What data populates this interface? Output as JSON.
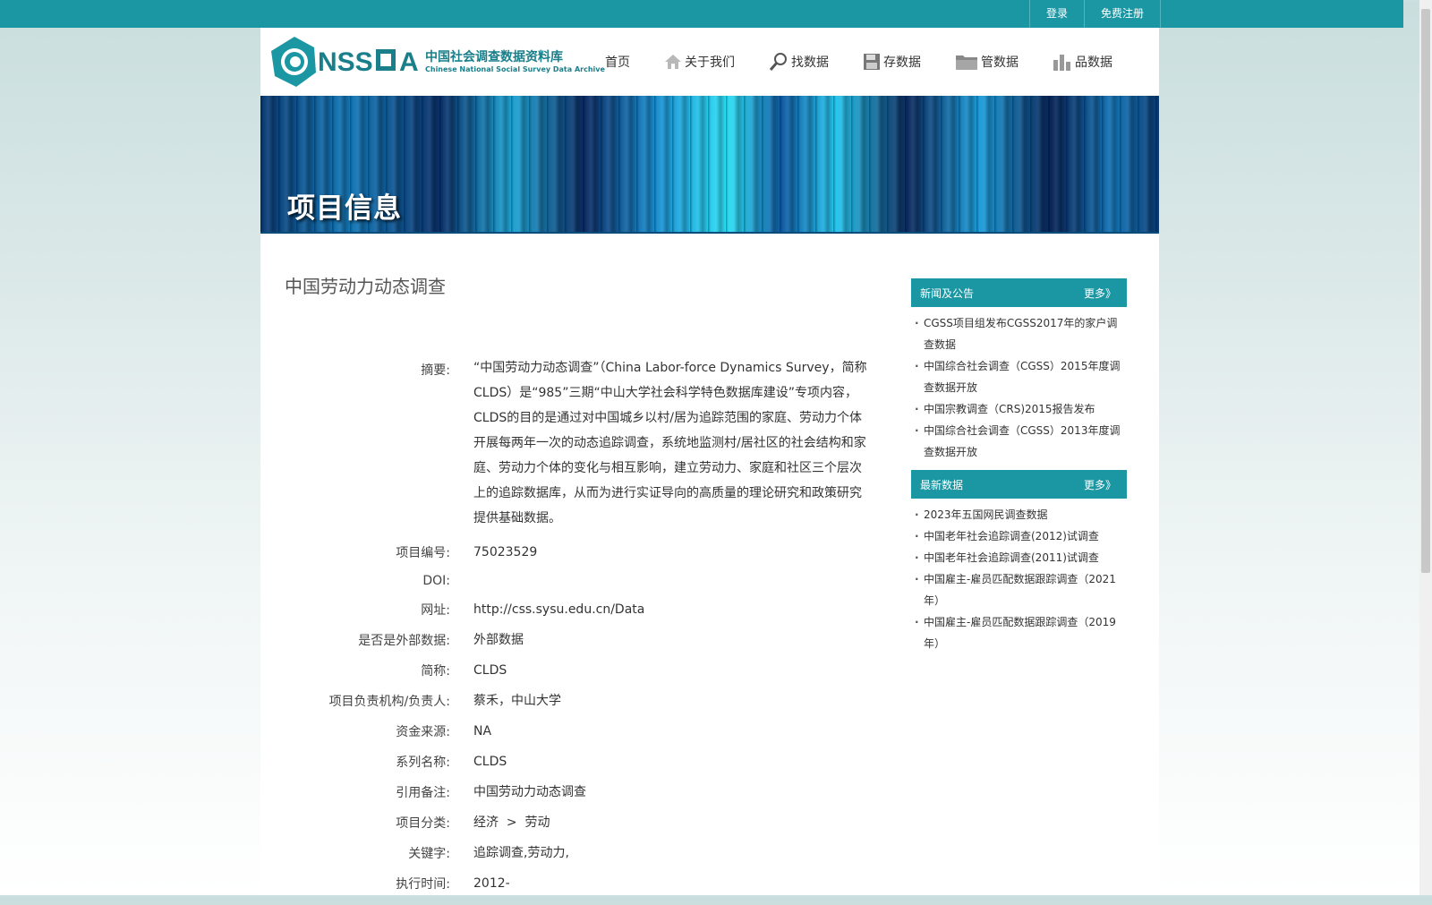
{
  "topbar": {
    "links": [
      "登录",
      "免费注册"
    ],
    "bg_color": "#1a97a3"
  },
  "logo": {
    "mark_text": "CNSSDA",
    "cn_title": "中国社会调查数据资料库",
    "en_title": "Chinese National Social Survey Data Archive"
  },
  "nav": {
    "items": [
      {
        "label": "首页",
        "icon": ""
      },
      {
        "label": "关于我们",
        "icon": "house-icon"
      },
      {
        "label": "找数据",
        "icon": "search-icon"
      },
      {
        "label": "存数据",
        "icon": "floppy-icon"
      },
      {
        "label": "管数据",
        "icon": "folder-icon"
      },
      {
        "label": "品数据",
        "icon": "bar-chart-icon"
      }
    ]
  },
  "banner": {
    "title": "项目信息"
  },
  "project": {
    "title": "中国劳动力动态调查",
    "fields": [
      {
        "label": "摘要:",
        "value": "“中国劳动力动态调查”（China Labor-force Dynamics Survey，简称CLDS）是“985”三期“中山大学社会科学特色数据库建设”专项内容，CLDS的目的是通过对中国城乡以村/居为追踪范围的家庭、劳动力个体开展每两年一次的动态追踪调查，系统地监测村/居社区的社会结构和家庭、劳动力个体的变化与相互影响，建立劳动力、家庭和社区三个层次上的追踪数据库，从而为进行实证导向的高质量的理论研究和政策研究提供基础数据。"
      },
      {
        "label": "项目编号:",
        "value": "75023529"
      },
      {
        "label": "DOI:",
        "value": ""
      },
      {
        "label": "网址:",
        "value": "http://css.sysu.edu.cn/Data"
      },
      {
        "label": "是否是外部数据:",
        "value": "外部数据"
      },
      {
        "label": "简称:",
        "value": "CLDS"
      },
      {
        "label": "项目负责机构/负责人:",
        "value": "蔡禾，中山大学"
      },
      {
        "label": "资金来源:",
        "value": "NA"
      },
      {
        "label": "系列名称:",
        "value": "CLDS"
      },
      {
        "label": "引用备注:",
        "value": "中国劳动力动态调查"
      },
      {
        "label": "项目分类:",
        "value": "经济  >  劳动"
      },
      {
        "label": "关键字:",
        "value": "追踪调查,劳动力,"
      },
      {
        "label": "执行时间:",
        "value": "2012-"
      }
    ]
  },
  "sidebar": {
    "news": {
      "title": "新闻及公告",
      "more": "更多》",
      "items": [
        "CGSS项目组发布CGSS2017年的家户调查数据",
        "中国综合社会调查（CGSS）2015年度调查数据开放",
        "中国宗教调查（CRS)2015报告发布",
        "中国综合社会调查（CGSS）2013年度调查数据开放"
      ]
    },
    "latest": {
      "title": "最新数据",
      "more": "更多》",
      "items": [
        "2023年五国网民调查数据",
        "中国老年社会追踪调查(2012)试调查",
        "中国老年社会追踪调查(2011)试调查",
        "中国雇主-雇员匹配数据跟踪调查（2021年）",
        "中国雇主-雇员匹配数据跟踪调查（2019年）"
      ]
    }
  }
}
